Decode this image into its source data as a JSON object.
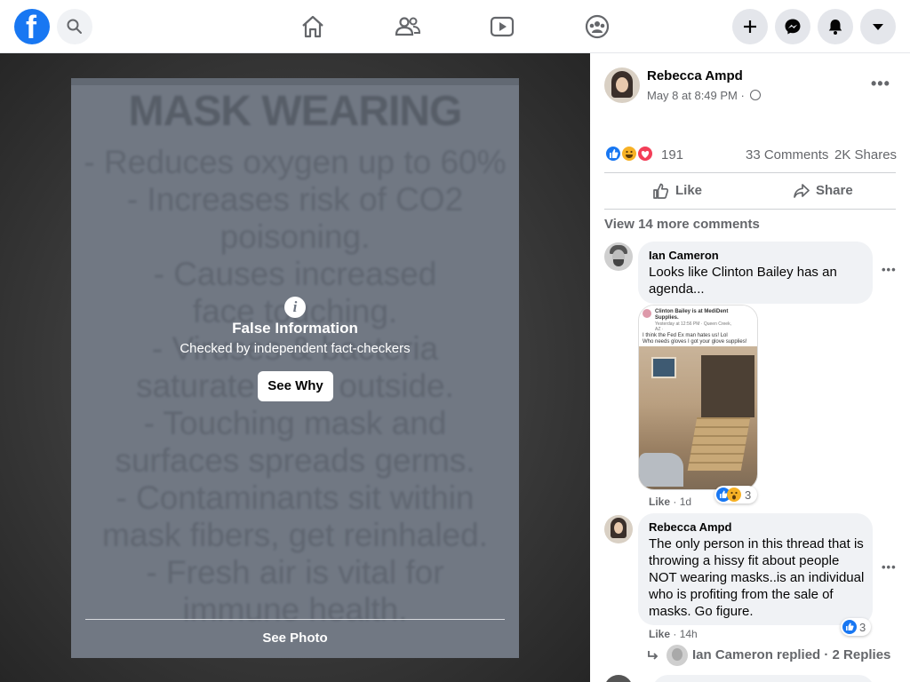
{
  "topbar": {
    "logo_letter": "f",
    "icons": [
      "search-icon",
      "home-icon",
      "friends-icon",
      "watch-icon",
      "groups-icon",
      "plus-icon",
      "messenger-icon",
      "notifications-icon",
      "caret-down-icon"
    ]
  },
  "photo": {
    "bg_text": {
      "title": "MASK WEARING",
      "lines": [
        "- Reduces oxygen up to 60%",
        "- Increases risk of CO2",
        "poisoning.",
        "- Causes increased",
        "face touching.",
        "- Viruses & bacteria",
        "saturate from outside.",
        "- Touching mask and",
        "surfaces spreads germs.",
        "- Contaminants sit within",
        "mask fibers, get reinhaled.",
        "- Fresh air is vital for",
        "immune health."
      ]
    },
    "warning_title": "False Information",
    "warning_subtitle": "Checked by independent fact-checkers",
    "see_why_label": "See Why",
    "see_photo_label": "See Photo"
  },
  "post": {
    "author": "Rebecca Ampd",
    "timestamp": "May 8 at 8:49 PM · ",
    "reaction_count": "191",
    "comments": "33 Comments",
    "shares": "2K Shares",
    "like_label": "Like",
    "share_label": "Share",
    "view_more": "View 14 more comments"
  },
  "comments": [
    {
      "name": "Ian Cameron",
      "text_lines": [
        "Looks like Clinton Bailey has an",
        "agenda..."
      ],
      "like": "Like",
      "time": "1d",
      "reaction_count": "3",
      "image": {
        "lines": [
          "Clinton Bailey is at MediDent",
          "Supplies.",
          "Yesterday at 12:56 PM · Queen Creek,",
          "AZ · ",
          "I think the Fed Ex man hates us! Lol",
          "Who needs gloves I got your glove supplies!"
        ]
      }
    },
    {
      "name": "Rebecca Ampd",
      "text_lines": [
        "The only person in this thread that is",
        "throwing a hissy fit about people",
        "NOT wearing masks..is an individual",
        "who is profiting from the sale of",
        "masks. Go figure."
      ],
      "like": "Like",
      "time": "14h",
      "reaction_count": "3"
    }
  ],
  "replies": {
    "text": "Ian Cameron replied · 2 Replies"
  },
  "colors": {
    "brand": "#1877f2",
    "like_blue": "#1877f2",
    "love_red": "#f33e58",
    "haha_yellow": "#f7b125"
  }
}
